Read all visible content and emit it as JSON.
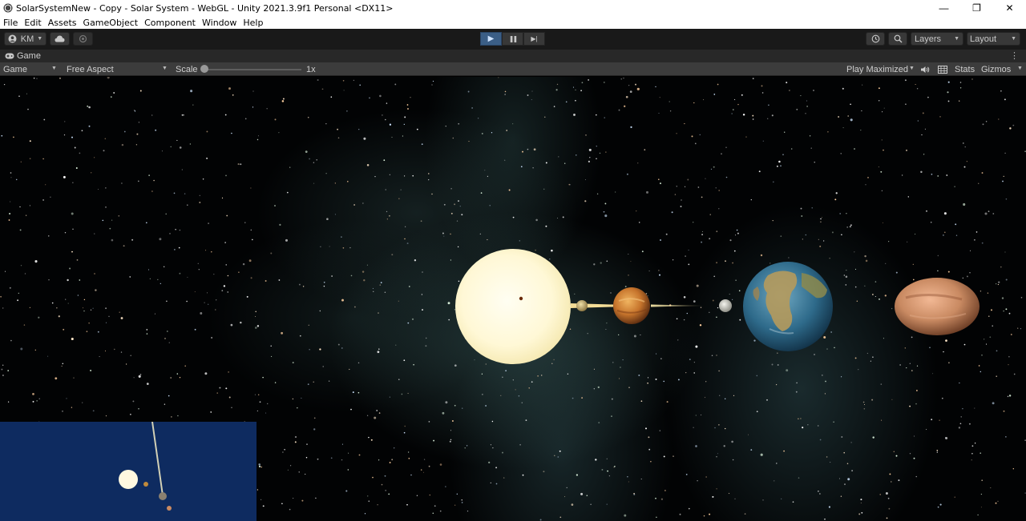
{
  "window": {
    "title": "SolarSystemNew - Copy - Solar System - WebGL - Unity 2021.3.9f1 Personal <DX11>",
    "app_icon": "unity-icon",
    "controls": {
      "minimize": "—",
      "maximize": "❐",
      "close": "✕"
    }
  },
  "menu": [
    "File",
    "Edit",
    "Assets",
    "GameObject",
    "Component",
    "Window",
    "Help"
  ],
  "toolbar": {
    "account_label": "KM",
    "account_icon": "user-icon",
    "cloud_icon": "cloud-icon",
    "collab_icon": "collab-icon",
    "play_icon": "▶",
    "pause_icon": "❚❚",
    "step_icon": "▶|",
    "play_active": true,
    "history_icon": "history-icon",
    "search_icon": "search-icon",
    "layers_label": "Layers",
    "layout_label": "Layout"
  },
  "tab": {
    "label": "Game",
    "icon": "gamepad-icon",
    "more": "⋮"
  },
  "game_controls": {
    "display_label": "Game",
    "aspect_label": "Free Aspect",
    "scale_label": "Scale",
    "scale_value": "1x",
    "scale_fraction": 0.0,
    "play_mode_label": "Play Maximized",
    "audio_icon": "speaker-icon",
    "stats_icon": "stats-icon",
    "stats_label": "Stats",
    "gizmos_label": "Gizmos"
  },
  "scene": {
    "bodies": [
      "sun",
      "mercury",
      "venus",
      "moon",
      "earth",
      "mars"
    ],
    "colors": {
      "sun": "#fff8d8",
      "venus": "#c8762a",
      "earth_ocean": "#2e6a8a",
      "mars": "#c98a62",
      "minimap_bg": "#0e2b60"
    }
  }
}
